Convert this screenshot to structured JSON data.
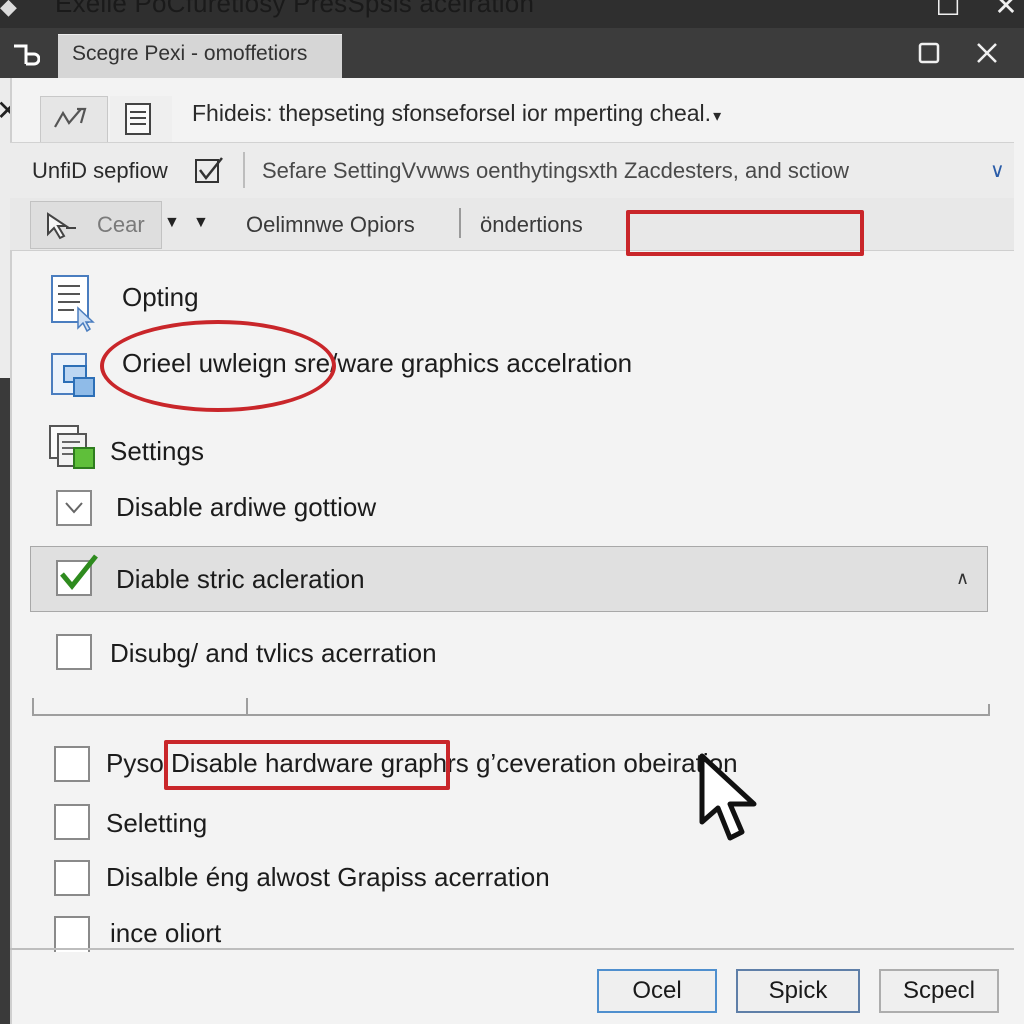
{
  "window": {
    "outer_title": "Exelle PoCfuretiosy PresSpsis  acelration",
    "tab_title": "Scegre  Pexi - omoffetiors",
    "app_logo": "ъ",
    "minimize": "☐",
    "close": "✕",
    "left_close": "✕"
  },
  "address": {
    "text": "Fhideis: thepseting sfonseforsel ior mperting cheal.",
    "chevron": "▾"
  },
  "toolbar1": {
    "label": "UnfiD sepfiow",
    "check": "✓",
    "text": "Sefare SettingVvwws oenthytingsxth Zacdesters, and sctiow",
    "chevron": "∨"
  },
  "toolbar2": {
    "clear_label": "Cear",
    "dropdown_a": "▼",
    "dropdown_b": "▼",
    "options_label": "Oelimnwe Opiors",
    "conditions_label": "öndertions"
  },
  "options": [
    {
      "label": "Opting"
    },
    {
      "label": "Orieel uwleign sre/ware graphics accelration"
    },
    {
      "label": "Settings"
    },
    {
      "label": "Disable ardiwe gottiow"
    },
    {
      "label": "Diable stric acleration",
      "checked": true
    },
    {
      "label": "Disubg/ and tvlics acerration"
    }
  ],
  "lower_options": [
    {
      "label": "Pyso Disable hardware graphrs g’ceveration  obeiration"
    },
    {
      "label": "Seletting"
    },
    {
      "label": "Disalble éng alwost Grapiss acerration"
    },
    {
      "label": "ince oliort"
    }
  ],
  "buttons": {
    "ocel": "Ocel",
    "spick": "Spick",
    "scpecl": "Scpecl"
  },
  "colors": {
    "annotation_red": "#c9262a",
    "check_green": "#2e8b1e",
    "accent_blue": "#4f8fce"
  }
}
